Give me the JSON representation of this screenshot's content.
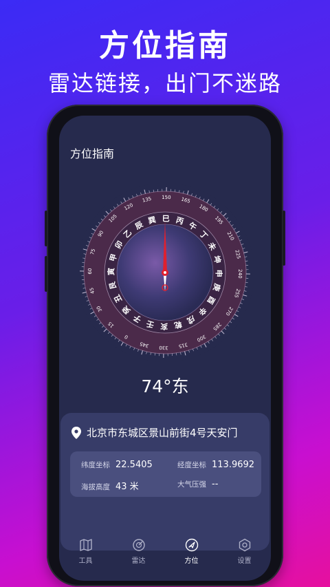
{
  "promo": {
    "title": "方位指南",
    "subtitle": "雷达链接，出门不迷路"
  },
  "app": {
    "title": "方位指南"
  },
  "compass": {
    "heading_degrees": 74,
    "heading_text": "74°东",
    "mountains_outer": [
      "甲",
      "卯",
      "乙",
      "辰",
      "巽",
      "巳",
      "丙",
      "午",
      "丁",
      "未",
      "坤",
      "申",
      "庚",
      "酉",
      "辛",
      "戌",
      "乾",
      "亥",
      "壬",
      "子",
      "癸",
      "丑",
      "艮",
      "寅"
    ],
    "degree_marks": [
      "75",
      "90",
      "105",
      "120",
      "135",
      "150",
      "165",
      "180",
      "195",
      "210",
      "225",
      "240",
      "255",
      "270",
      "285",
      "300",
      "315",
      "330",
      "345",
      "0",
      "15",
      "30",
      "45",
      "60"
    ],
    "colors": {
      "needle": "#e0202e",
      "ring": "#4b2a4a",
      "dial": "#2d2f55"
    }
  },
  "location": {
    "address": "北京市东城区景山前街4号天安门",
    "latitude_label": "纬度坐标",
    "latitude_value": "22.5405",
    "longitude_label": "经度坐标",
    "longitude_value": "113.9692",
    "altitude_label": "海拔高度",
    "altitude_value": "43 米",
    "pressure_label": "大气压强",
    "pressure_value": "--"
  },
  "tabs": [
    {
      "label": "工具",
      "icon": "map-icon"
    },
    {
      "label": "雷达",
      "icon": "radar-icon"
    },
    {
      "label": "方位",
      "icon": "navigation-arrow-icon",
      "active": true
    },
    {
      "label": "设置",
      "icon": "settings-hexagon-icon"
    }
  ]
}
